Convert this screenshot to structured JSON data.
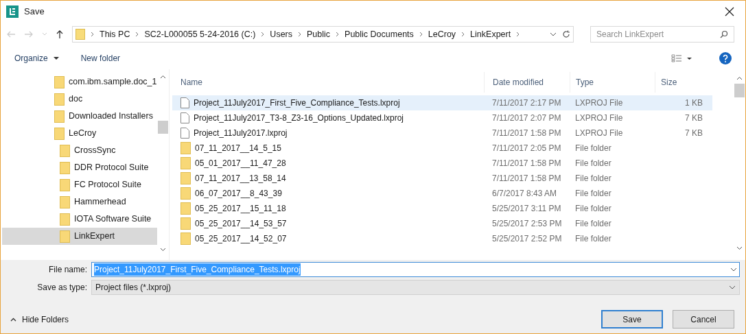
{
  "window": {
    "title": "Save"
  },
  "breadcrumb": [
    "This PC",
    "SC2-L000055 5-24-2016 (C:)",
    "Users",
    "Public",
    "Public Documents",
    "LeCroy",
    "LinkExpert"
  ],
  "search": {
    "placeholder": "Search LinkExpert"
  },
  "toolbar": {
    "organize": "Organize",
    "new_folder": "New folder"
  },
  "sidebar": {
    "items": [
      {
        "label": "com.ibm.sample.doc_1",
        "selected": false
      },
      {
        "label": "doc",
        "selected": false
      },
      {
        "label": "Downloaded Installers",
        "selected": false
      },
      {
        "label": "LeCroy",
        "selected": false,
        "children": [
          {
            "label": "CrossSync",
            "selected": false
          },
          {
            "label": "DDR Protocol Suite",
            "selected": false
          },
          {
            "label": "FC Protocol Suite",
            "selected": false
          },
          {
            "label": "Hammerhead",
            "selected": false
          },
          {
            "label": "IOTA Software Suite",
            "selected": false
          },
          {
            "label": "LinkExpert",
            "selected": true
          }
        ]
      }
    ]
  },
  "table": {
    "columns": [
      "Name",
      "Date modified",
      "Type",
      "Size"
    ],
    "rows": [
      {
        "kind": "file",
        "selected": true,
        "name": "Project_11July2017_First_Five_Compliance_Tests.lxproj",
        "date": "7/11/2017 2:17 PM",
        "type": "LXPROJ File",
        "size": "1 KB"
      },
      {
        "kind": "file",
        "selected": false,
        "name": "Project_11July2017_T3-8_Z3-16_Options_Updated.lxproj",
        "date": "7/11/2017 2:07 PM",
        "type": "LXPROJ File",
        "size": "7 KB"
      },
      {
        "kind": "file",
        "selected": false,
        "name": "Project_11July2017.lxproj",
        "date": "7/11/2017 1:58 PM",
        "type": "LXPROJ File",
        "size": "7 KB"
      },
      {
        "kind": "folder",
        "selected": false,
        "name": "07_11_2017__14_5_15",
        "date": "7/11/2017 2:05 PM",
        "type": "File folder"
      },
      {
        "kind": "folder",
        "selected": false,
        "name": "05_01_2017__11_47_28",
        "date": "7/11/2017 1:58 PM",
        "type": "File folder"
      },
      {
        "kind": "folder",
        "selected": false,
        "name": "07_11_2017__13_58_14",
        "date": "7/11/2017 1:58 PM",
        "type": "File folder"
      },
      {
        "kind": "folder",
        "selected": false,
        "name": "06_07_2017__8_43_39",
        "date": "6/7/2017 8:43 AM",
        "type": "File folder"
      },
      {
        "kind": "folder",
        "selected": false,
        "name": "05_25_2017__15_11_18",
        "date": "5/25/2017 3:11 PM",
        "type": "File folder"
      },
      {
        "kind": "folder",
        "selected": false,
        "name": "05_25_2017__14_53_57",
        "date": "5/25/2017 2:53 PM",
        "type": "File folder"
      },
      {
        "kind": "folder",
        "selected": false,
        "name": "05_25_2017__14_52_07",
        "date": "5/25/2017 2:52 PM",
        "type": "File folder"
      }
    ]
  },
  "file_name": {
    "label": "File name:",
    "value": "Project_11July2017_First_Five_Compliance_Tests.lxproj",
    "selected": true
  },
  "save_as_type": {
    "label": "Save as type:",
    "value": "Project files (*.lxproj)"
  },
  "hide_folders": "Hide Folders",
  "buttons": {
    "save": "Save",
    "cancel": "Cancel"
  }
}
